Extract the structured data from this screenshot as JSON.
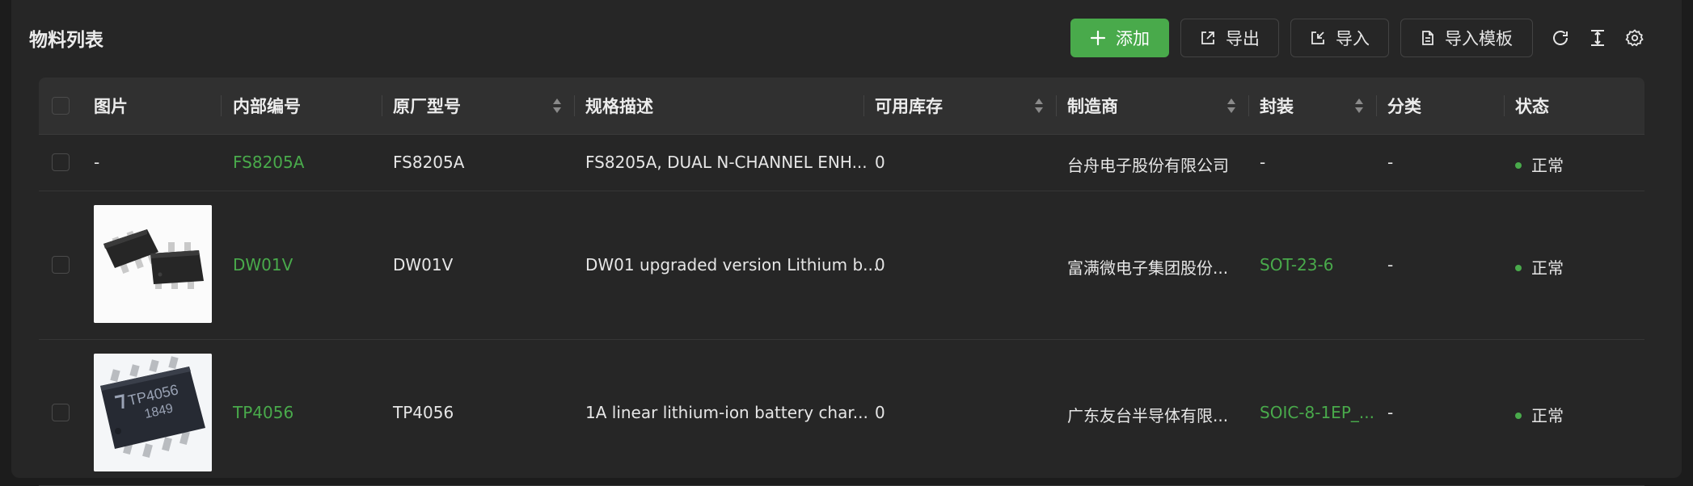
{
  "page": {
    "title": "物料列表"
  },
  "toolbar": {
    "add_label": "添加",
    "export_label": "导出",
    "import_label": "导入",
    "template_label": "导入模板"
  },
  "table": {
    "headers": {
      "image": "图片",
      "internal_no": "内部编号",
      "mfr_part": "原厂型号",
      "spec": "规格描述",
      "stock": "可用库存",
      "manufacturer": "制造商",
      "package": "封装",
      "category": "分类",
      "status": "状态"
    },
    "rows": [
      {
        "image": "-",
        "internal_no": "FS8205A",
        "mfr_part": "FS8205A",
        "spec": "FS8205A, DUAL N-CHANNEL ENH...",
        "stock": "0",
        "manufacturer": "台舟电子股份有限公司",
        "package": "-",
        "category": "-",
        "status": "正常"
      },
      {
        "image": "chip-sot23-photo",
        "internal_no": "DW01V",
        "mfr_part": "DW01V",
        "spec": "DW01 upgraded version Lithium b...",
        "stock": "0",
        "manufacturer": "富满微电子集团股份...",
        "package": "SOT-23-6",
        "category": "-",
        "status": "正常"
      },
      {
        "image": "chip-soic8-photo",
        "chip_marking_line1": "TP4056",
        "chip_marking_line2": "1849",
        "internal_no": "TP4056",
        "mfr_part": "TP4056",
        "spec": "1A linear lithium-ion battery char...",
        "stock": "0",
        "manufacturer": "广东友台半导体有限...",
        "package": "SOIC-8-1EP_...",
        "category": "-",
        "status": "正常"
      }
    ]
  },
  "colors": {
    "accent": "#49aa4b",
    "background": "#1c1c1c",
    "card": "#262626",
    "header": "#303030"
  }
}
